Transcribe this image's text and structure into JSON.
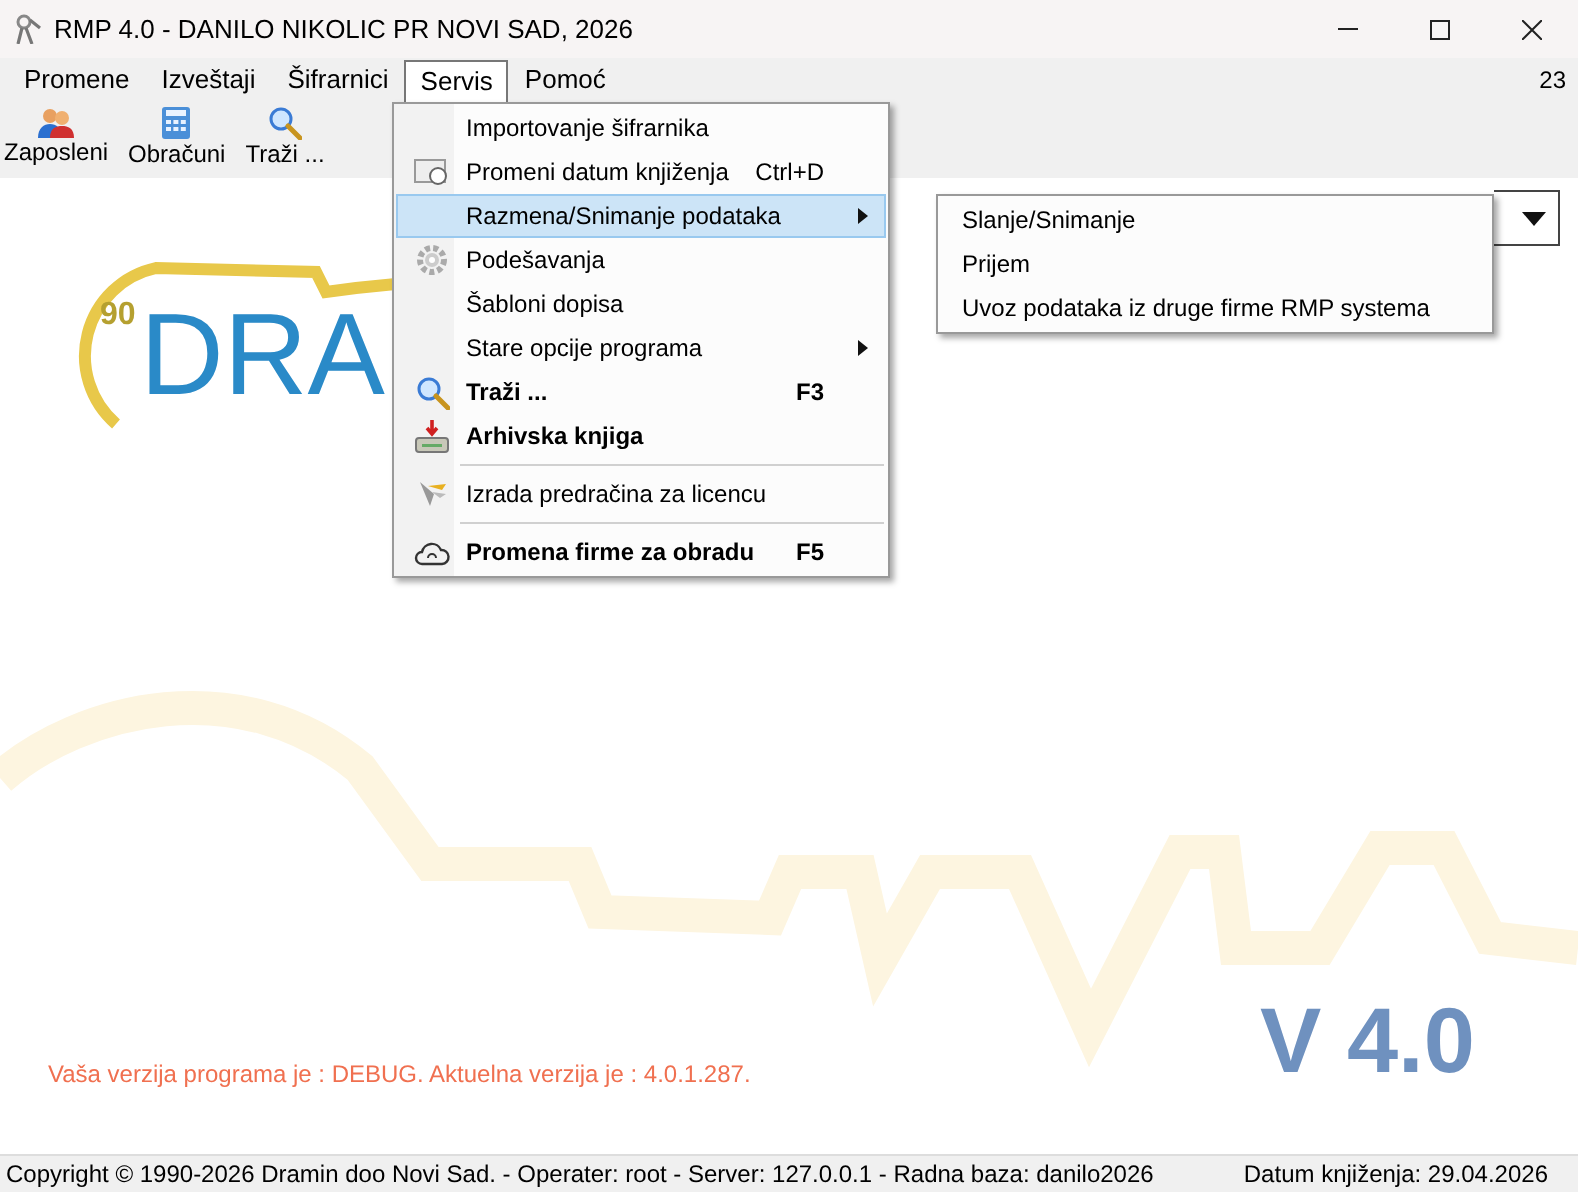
{
  "window": {
    "title": "RMP 4.0 - DANILO NIKOLIC PR NOVI SAD, 2026"
  },
  "menu_bar": {
    "items": [
      {
        "label": "Promene",
        "selected": false
      },
      {
        "label": "Izveštaji",
        "selected": false
      },
      {
        "label": "Šifrarnici",
        "selected": false
      },
      {
        "label": "Servis",
        "selected": true
      },
      {
        "label": "Pomoć",
        "selected": false
      }
    ],
    "counter": "23"
  },
  "toolbar": [
    {
      "label": "Zaposleni"
    },
    {
      "label": "Obračuni"
    },
    {
      "label": "Traži ..."
    }
  ],
  "logo": {
    "badge": "90",
    "text": "DRA"
  },
  "servis_menu": [
    {
      "kind": "item",
      "label": "Importovanje šifrarnika",
      "bold": false,
      "selected": false
    },
    {
      "kind": "item",
      "label": "Promeni datum knjiženja",
      "shortcut": "Ctrl+D",
      "bold": false,
      "selected": false
    },
    {
      "kind": "item",
      "label": "Razmena/Snimanje podataka",
      "submenu": true,
      "bold": false,
      "selected": true
    },
    {
      "kind": "item",
      "label": "Podešavanja",
      "bold": false,
      "selected": false
    },
    {
      "kind": "item",
      "label": "Šabloni dopisa",
      "bold": false,
      "selected": false
    },
    {
      "kind": "item",
      "label": "Stare opcije programa",
      "submenu": true,
      "bold": false,
      "selected": false
    },
    {
      "kind": "item",
      "label": "Traži ...",
      "shortcut": "F3",
      "bold": true,
      "selected": false
    },
    {
      "kind": "item",
      "label": "Arhivska knjiga",
      "bold": true,
      "selected": false
    },
    {
      "kind": "separator"
    },
    {
      "kind": "item",
      "label": "Izrada predračina za licencu",
      "bold": false,
      "selected": false
    },
    {
      "kind": "separator"
    },
    {
      "kind": "item",
      "label": "Promena firme za obradu",
      "shortcut": "F5",
      "bold": true,
      "selected": false
    }
  ],
  "submenu": [
    {
      "label": "Slanje/Snimanje"
    },
    {
      "label": "Prijem"
    },
    {
      "label": "Uvoz podataka iz druge firme RMP systema"
    }
  ],
  "version_message": "Vaša verzija programa je : DEBUG. Aktuelna verzija je : 4.0.1.287.",
  "version_badge": "V 4.0",
  "status_bar": {
    "left": "Copyright © 1990-2026 Dramin doo Novi Sad. - Operater: root - Server: 127.0.0.1 - Radna baza: danilo2026",
    "right": "Datum knjiženja: 29.04.2026"
  }
}
